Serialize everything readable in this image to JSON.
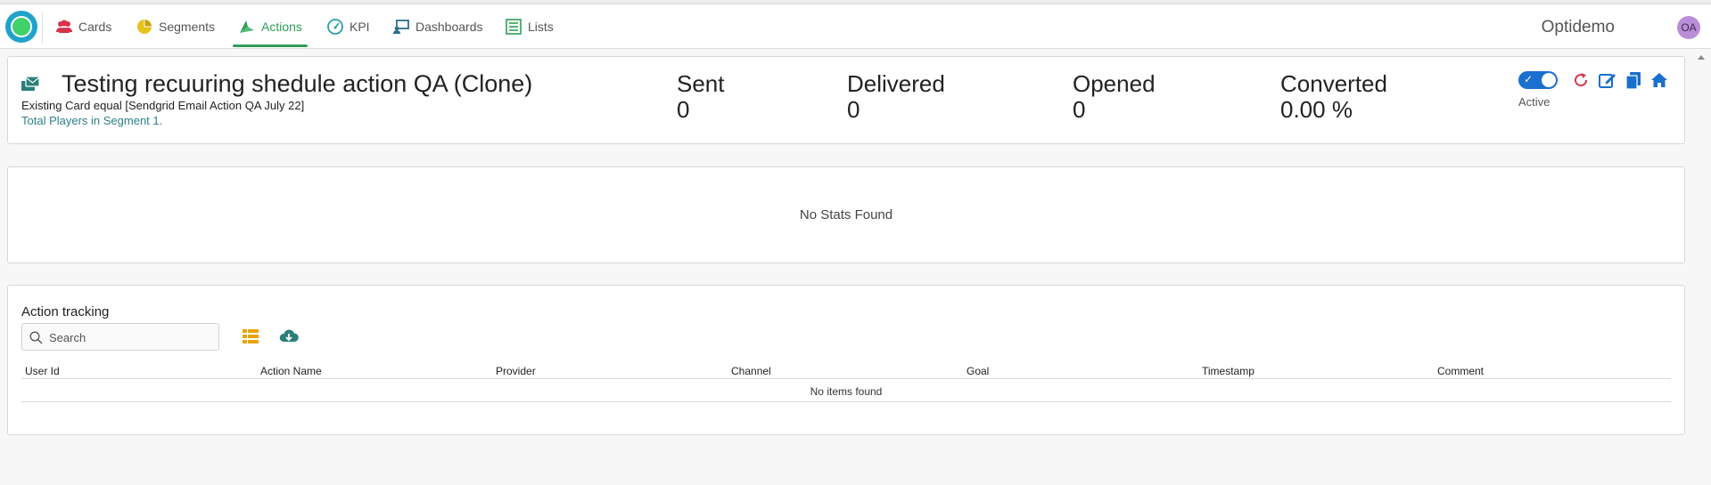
{
  "nav": {
    "items": [
      {
        "label": "Cards",
        "icon": "users-icon",
        "color": "#d9324b"
      },
      {
        "label": "Segments",
        "icon": "pie-chart-icon",
        "color": "#e8c21a"
      },
      {
        "label": "Actions",
        "icon": "paper-plane-icon",
        "color": "#2e9e57"
      },
      {
        "label": "KPI",
        "icon": "gauge-icon",
        "color": "#2a9fb0"
      },
      {
        "label": "Dashboards",
        "icon": "presentation-icon",
        "color": "#2a6f8f"
      },
      {
        "label": "Lists",
        "icon": "list-icon",
        "color": "#2e9e57"
      }
    ],
    "active": "Actions",
    "brand": "Optidemo",
    "avatar": "OA"
  },
  "action": {
    "title": "Testing recuuring shedule action QA (Clone)",
    "description": "Existing Card equal [Sendgrid Email Action QA July 22]",
    "segment_text": "Total Players in Segment 1.",
    "status_label": "Active"
  },
  "stats": [
    {
      "label": "Sent",
      "value": "0"
    },
    {
      "label": "Delivered",
      "value": "0"
    },
    {
      "label": "Opened",
      "value": "0"
    },
    {
      "label": "Converted",
      "value": "0.00 %"
    }
  ],
  "stats_panel": {
    "empty_text": "No Stats Found"
  },
  "tracking": {
    "title": "Action tracking",
    "search_placeholder": "Search",
    "columns": [
      "User Id",
      "Action Name",
      "Provider",
      "Channel",
      "Goal",
      "Timestamp",
      "Comment"
    ],
    "empty_text": "No items found"
  },
  "colors": {
    "accent": "#2e9e57",
    "toggle": "#1a6fcf",
    "tool_blue": "#1a6fcf",
    "refresh_red": "#d9324b"
  }
}
